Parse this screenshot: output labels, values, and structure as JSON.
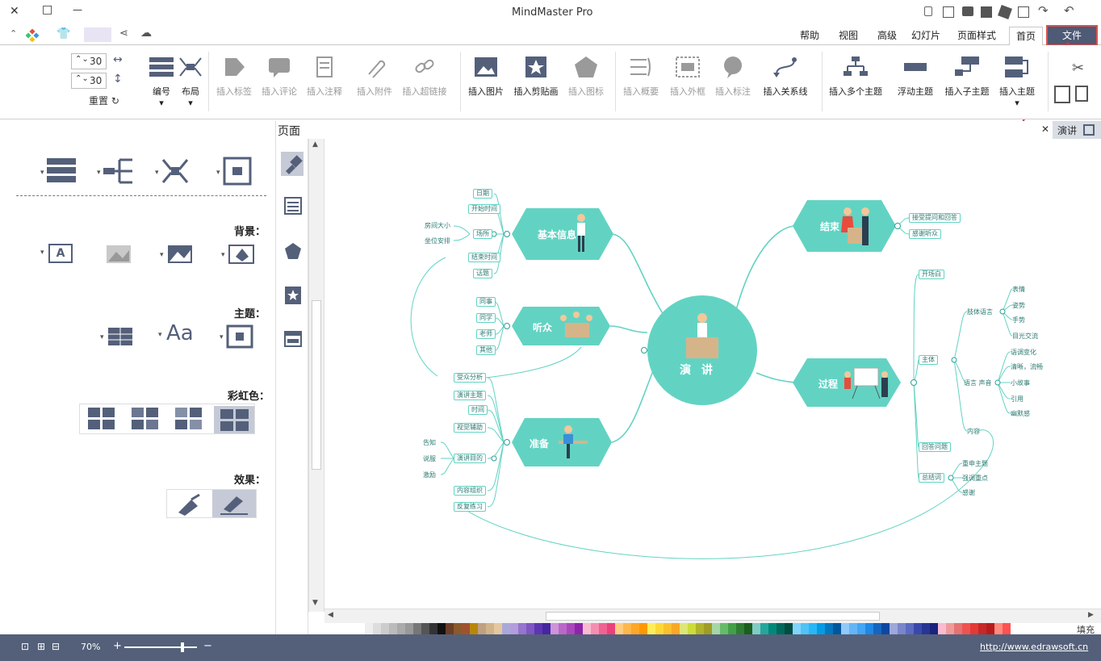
{
  "window": {
    "title": "MindMaster Pro",
    "minimize": "—",
    "maximize": "□",
    "close": "✕"
  },
  "tabs": [
    {
      "label": "文件"
    },
    {
      "label": "首页"
    },
    {
      "label": "页面样式"
    },
    {
      "label": "幻灯片"
    },
    {
      "label": "高级"
    },
    {
      "label": "视图"
    },
    {
      "label": "帮助"
    }
  ],
  "ribbon": {
    "insert_topic": "插入主题",
    "insert_subtopic": "插入子主题",
    "floating_topic": "浮动主题",
    "insert_multi": "插入多个主题",
    "relation": "插入关系线",
    "callout": "插入标注",
    "boundary": "插入外框",
    "summary": "插入概要",
    "icon": "插入图标",
    "clipart": "插入剪贴画",
    "picture": "插入图片",
    "hyperlink": "插入超链接",
    "attachment": "插入附件",
    "note": "插入注释",
    "comment": "插入评论",
    "tag": "插入标签",
    "numbering": "编号",
    "layout": "布局",
    "reset": "重置",
    "spin1": "30",
    "spin2": "30"
  },
  "presentation_tab": "演讲",
  "page_panel_title": "页面",
  "left_panel": {
    "background": "背景：",
    "theme": "主题：",
    "rainbow": "彩虹色：",
    "effect": "效果：",
    "font_sample": "Aa",
    "bg_a": "A"
  },
  "mindmap": {
    "center": "演  讲",
    "branches": [
      "基本信息",
      "听众",
      "准备",
      "结束",
      "过程"
    ],
    "basic_items": [
      "日期",
      "开始时间",
      "场所",
      "结束时间",
      "话题"
    ],
    "venue_items": [
      "房间大小",
      "坐位安排"
    ],
    "audience_items": [
      "同事",
      "同学",
      "老师",
      "其他"
    ],
    "prep_items": [
      "受众分析",
      "演讲主题",
      "时间",
      "视觉辅助",
      "演讲目的",
      "内容组织",
      "反复练习"
    ],
    "purpose_items": [
      "告知",
      "说服",
      "激励"
    ],
    "end_items": [
      "接受提问和回答",
      "感谢听众"
    ],
    "process_items": [
      "开场白",
      "主体",
      "回答问题",
      "总结词"
    ],
    "body_items": [
      "肢体语言",
      "语言  声音",
      "内容"
    ],
    "body_lang_items": [
      "表情",
      "姿势",
      "手势",
      "目光交流"
    ],
    "voice_items": [
      "语调变化",
      "清晰，流畅",
      "小故事",
      "引用",
      "幽默感"
    ],
    "summary_items": [
      "重申主题",
      "强调重点",
      "感谢"
    ]
  },
  "status": {
    "url": "http://www.edrawsoft.cn",
    "zoom": "70%",
    "fill_label": "填充"
  },
  "colors": {
    "accent": "#54607a",
    "teal": "#62d3c3",
    "red_annotation": "#e03b3b"
  },
  "palette": [
    "#ffffff",
    "#eeeeee",
    "#dddddd",
    "#cccccc",
    "#bbbbbb",
    "#aaaaaa",
    "#999999",
    "#777777",
    "#555555",
    "#333333",
    "#111111",
    "#6b3e26",
    "#8b5a2b",
    "#a0522d",
    "#b8860b",
    "#c0a080",
    "#d2b48c",
    "#e6c8a0",
    "#a9a9d9",
    "#b39ddb",
    "#9575cd",
    "#7e57c2",
    "#5e35b1",
    "#4527a0",
    "#ce93d8",
    "#ba68c8",
    "#ab47bc",
    "#8e24aa",
    "#f8bbd0",
    "#f48fb1",
    "#f06292",
    "#ec407a",
    "#ffcc80",
    "#ffb74d",
    "#ffa726",
    "#ff9800",
    "#ffee58",
    "#fdd835",
    "#fbc02d",
    "#f9a825",
    "#dce775",
    "#cddc39",
    "#afb42b",
    "#9e9d24",
    "#a5d6a7",
    "#66bb6a",
    "#43a047",
    "#2e7d32",
    "#1b5e20",
    "#80cbc4",
    "#26a69a",
    "#00897b",
    "#00695c",
    "#004d40",
    "#81d4fa",
    "#4fc3f7",
    "#29b6f6",
    "#039be5",
    "#0277bd",
    "#01579b",
    "#90caf9",
    "#64b5f6",
    "#42a5f5",
    "#1e88e5",
    "#1565c0",
    "#0d47a1",
    "#9fa8da",
    "#7986cb",
    "#5c6bc0",
    "#3949ab",
    "#283593",
    "#1a237e",
    "#f8bbd0",
    "#ef9a9a",
    "#e57373",
    "#ef5350",
    "#e53935",
    "#c62828",
    "#b71c1c",
    "#ff8a80",
    "#ff5252"
  ]
}
